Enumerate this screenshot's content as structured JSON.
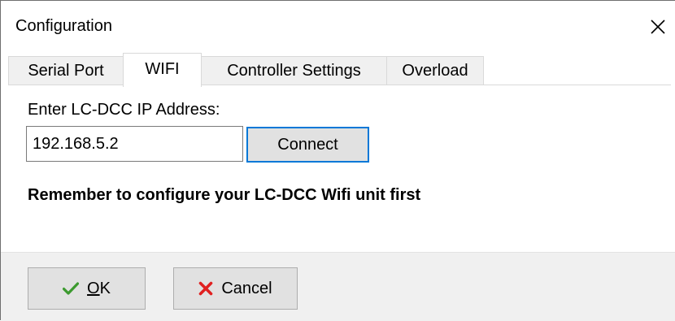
{
  "window": {
    "title": "Configuration",
    "close_icon": "close-icon"
  },
  "tabs": [
    {
      "label": "Serial Port",
      "active": false
    },
    {
      "label": "WIFI",
      "active": true
    },
    {
      "label": "Controller Settings",
      "active": false
    },
    {
      "label": "Overload",
      "active": false
    }
  ],
  "wifi": {
    "ip_label": "Enter LC-DCC IP Address:",
    "ip_value": "192.168.5.2",
    "connect_label": "Connect",
    "reminder": "Remember to configure your LC-DCC Wifi unit first"
  },
  "footer": {
    "ok_label_mnemonic": "O",
    "ok_label_rest": "K",
    "ok_icon": "checkmark-icon",
    "cancel_label": "Cancel",
    "cancel_icon": "x-icon"
  },
  "colors": {
    "accent": "#0078d7",
    "ok_icon": "#3c9a2f",
    "cancel_icon": "#e02020"
  }
}
